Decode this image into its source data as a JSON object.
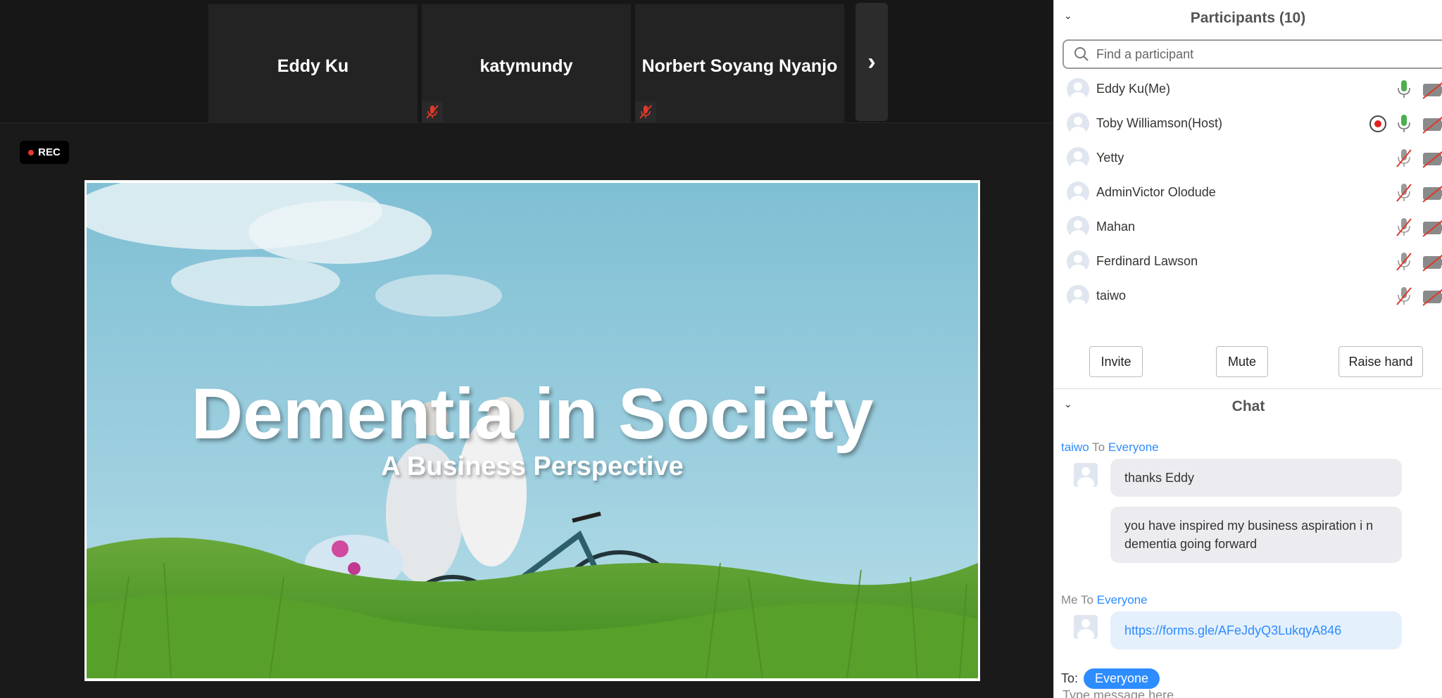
{
  "tiles": [
    {
      "name": "Eddy Ku",
      "muted": false
    },
    {
      "name": "katymundy",
      "muted": true
    },
    {
      "name": "Norbert Soyang Nyanjo",
      "muted": true
    }
  ],
  "rec_label": "REC",
  "slide": {
    "title": "Dementia in Society",
    "subtitle": "A Business Perspective"
  },
  "participants": {
    "header": "Participants (10)",
    "search_placeholder": "Find a participant",
    "items": [
      {
        "name": "Eddy Ku(Me)",
        "mic": "on",
        "recording": false
      },
      {
        "name": "Toby Williamson(Host)",
        "mic": "on",
        "recording": true
      },
      {
        "name": "Yetty",
        "mic": "muted",
        "recording": false
      },
      {
        "name": "AdminVictor Olodude",
        "mic": "muted",
        "recording": false
      },
      {
        "name": "Mahan",
        "mic": "muted",
        "recording": false
      },
      {
        "name": "Ferdinard Lawson",
        "mic": "muted",
        "recording": false
      },
      {
        "name": "taiwo",
        "mic": "muted",
        "recording": false
      }
    ],
    "buttons": {
      "invite": "Invite",
      "mute": "Mute",
      "raise_hand": "Raise hand"
    }
  },
  "chat": {
    "header": "Chat",
    "groups": [
      {
        "sender": "taiwo",
        "to_word": "To",
        "recipient": "Everyone",
        "messages": [
          "thanks Eddy",
          "you have inspired my business aspiration i n dementia going forward"
        ]
      },
      {
        "sender": "Me",
        "to_word": "To",
        "recipient": "Everyone",
        "messages": [
          "https://forms.gle/AFeJdyQ3LukqyA846"
        ]
      }
    ],
    "to_label": "To:",
    "to_value": "Everyone",
    "input_placeholder": "Type message here"
  },
  "colors": {
    "accent": "#2d8cff",
    "mic_on": "#4caf50",
    "muted_red": "#e0392b",
    "rec_dot": "#e8382e"
  }
}
